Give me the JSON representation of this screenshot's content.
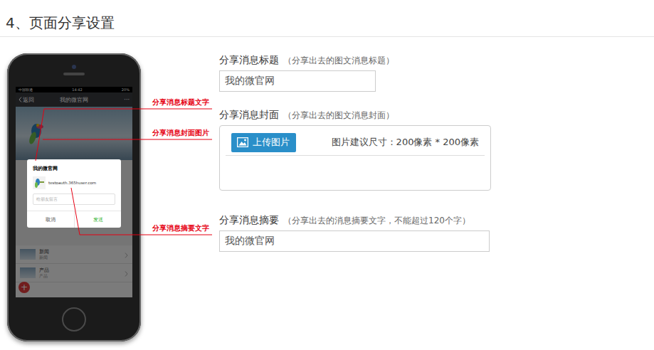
{
  "page": {
    "title": "4、页面分享设置"
  },
  "phone": {
    "status_bar": {
      "carrier": "中国联通",
      "time": "14:42",
      "battery": "20%"
    },
    "nav": {
      "back": "返回",
      "title": "我的微官网",
      "more": "···"
    },
    "share_dialog": {
      "title": "我的微官网",
      "url": "testoauth.365huser.com",
      "message_placeholder": "给朋友留言",
      "buttons": [
        {
          "label": "取消",
          "primary": false
        },
        {
          "label": "发送",
          "primary": true
        }
      ]
    },
    "list": [
      {
        "title": "新闻",
        "subtitle": "新闻"
      },
      {
        "title": "产品",
        "subtitle": "产品"
      }
    ],
    "fab": "+"
  },
  "annotations": [
    {
      "label": "分享消息标题文字"
    },
    {
      "label": "分享消息封面图片"
    },
    {
      "label": "分享消息摘要文字"
    }
  ],
  "form": {
    "fields": [
      {
        "kind": "text",
        "label": "分享消息标题",
        "hint": "（分享出去的图文消息标题）",
        "value": "我的微官网"
      },
      {
        "kind": "upload",
        "label": "分享消息封面",
        "hint": "（分享出去的图文消息封面）",
        "button": "上传图片",
        "note": "图片建议尺寸：200像素 * 200像素"
      },
      {
        "kind": "text",
        "label": "分享消息摘要",
        "hint": "（分享出去的消息摘要文字，不能超过120个字）",
        "value": "我的微官网"
      }
    ]
  }
}
